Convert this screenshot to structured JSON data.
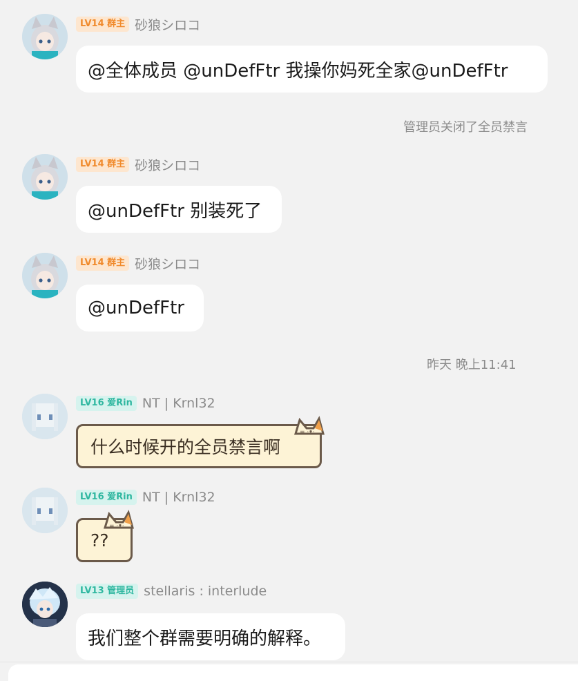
{
  "messages": [
    {
      "badge": "LV14 群主",
      "nick": "砂狼シロコ",
      "text": "@全体成员 @unDefFtr 我操你妈死全家@unDefFtr"
    },
    {
      "badge": "LV14 群主",
      "nick": "砂狼シロコ",
      "text": "@unDefFtr 别装死了"
    },
    {
      "badge": "LV14 群主",
      "nick": "砂狼シロコ",
      "text": "@unDefFtr"
    },
    {
      "badge": "LV16 爱Rin",
      "nick": "NT | Krnl32",
      "text": "什么时候开的全员禁言啊"
    },
    {
      "badge": "LV16 爱Rin",
      "nick": "NT | Krnl32",
      "text": "??"
    },
    {
      "badge": "LV13 管理员",
      "nick": "stellaris : interlude",
      "text": "我们整个群需要明确的解释。"
    }
  ],
  "system": {
    "mute_notice": "管理员关闭了全员禁言",
    "timestamp": "昨天 晚上11:41"
  },
  "colors": {
    "background": "#f2f2f2",
    "bubble": "#ffffff",
    "owner_badge_bg": "#fde6cf",
    "owner_badge_text": "#f08a2c",
    "member_badge_bg": "#d6f3ee",
    "member_badge_text": "#2fb7a0",
    "cat_bubble_bg": "#fdf3d6"
  },
  "icons": {
    "owner_avatar": "wolf-girl-avatar-icon",
    "member_avatar": "pixel-face-avatar-icon",
    "admin_avatar": "anime-boy-avatar-icon",
    "cat_ears": "cat-ears-icon"
  }
}
